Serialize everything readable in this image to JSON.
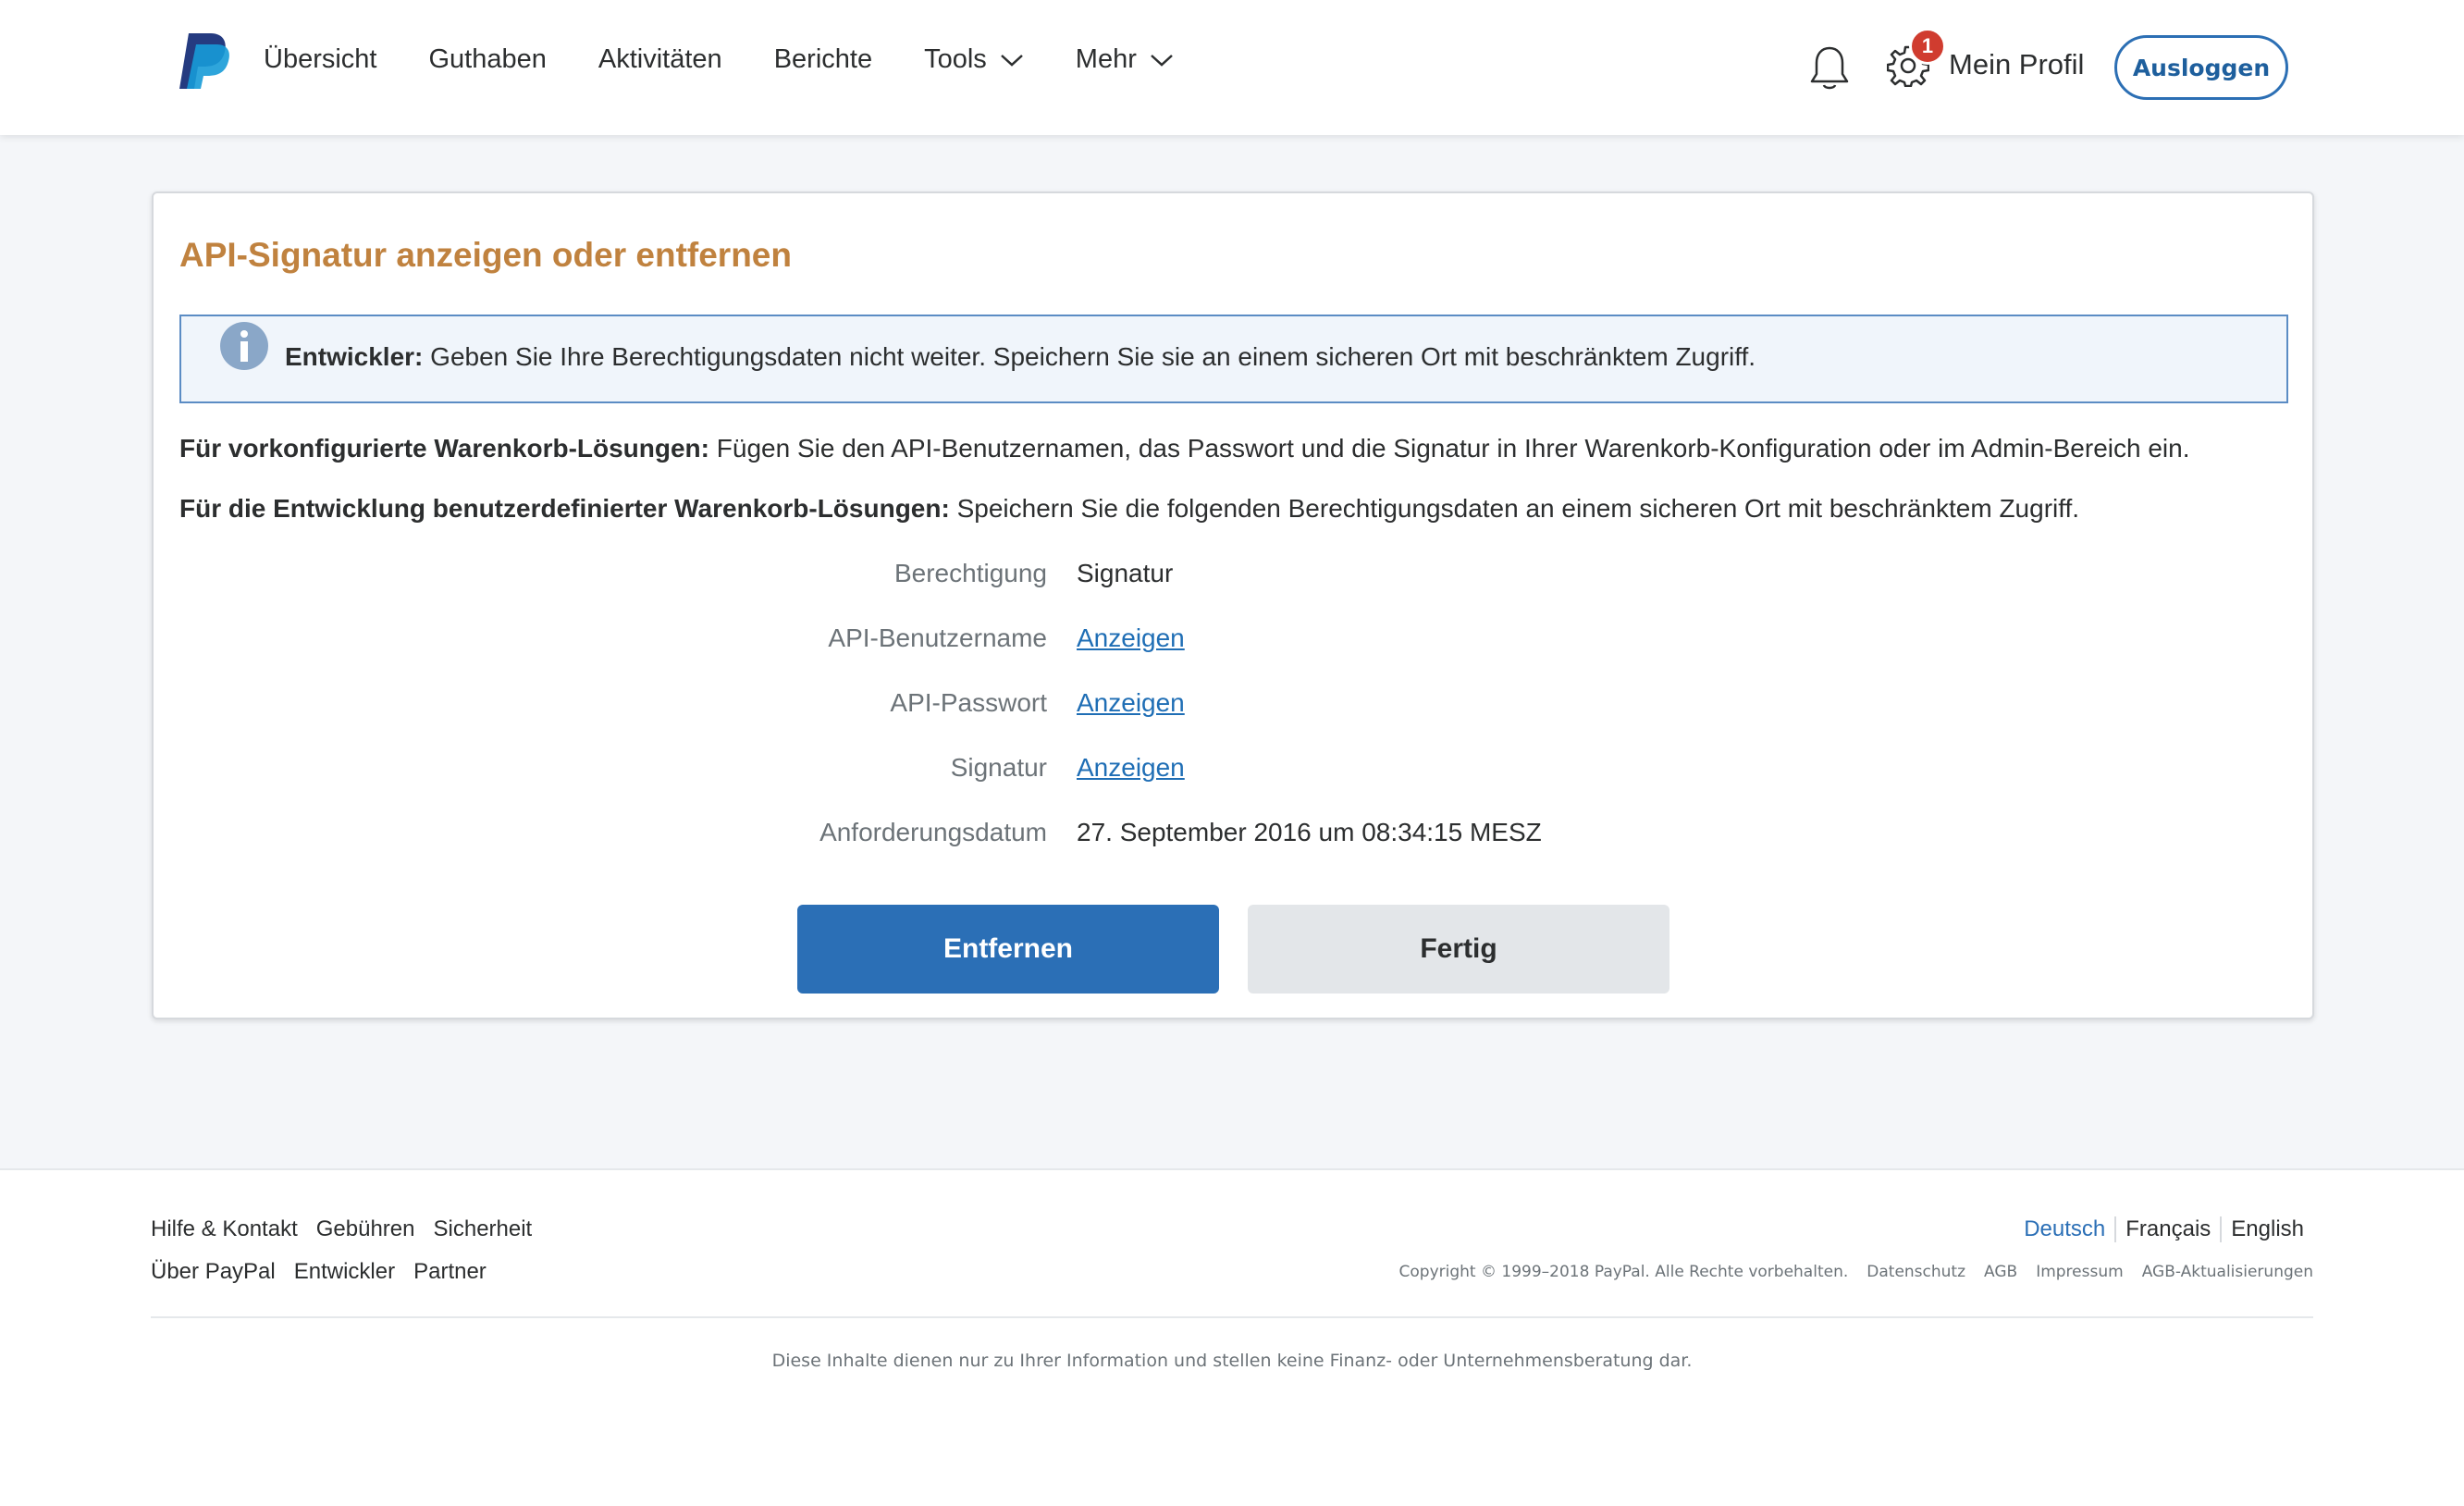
{
  "header": {
    "nav": [
      "Übersicht",
      "Guthaben",
      "Aktivitäten",
      "Berichte",
      "Tools",
      "Mehr"
    ],
    "notification_badge": "1",
    "profile_label": "Mein Profil",
    "logout_label": "Ausloggen"
  },
  "card": {
    "title": "API-Signatur anzeigen oder entfernen",
    "info_bold": "Entwickler:",
    "info_text": " Geben Sie Ihre Berechtigungsdaten nicht weiter. Speichern Sie sie an einem sicheren Ort mit beschränktem Zugriff.",
    "p1_bold": "Für vorkonfigurierte Warenkorb-Lösungen:",
    "p1_text": " Fügen Sie den API-Benutzernamen, das Passwort und die Signatur in Ihrer Warenkorb-Konfiguration oder im Admin-Bereich ein.",
    "p2_bold": "Für die Entwicklung benutzerdefinierter Warenkorb-Lösungen:",
    "p2_text": " Speichern Sie die folgenden Berechtigungsdaten an einem sicheren Ort mit beschränktem Zugriff.",
    "rows": [
      {
        "label": "Berechtigung",
        "value": "Signatur"
      },
      {
        "label": "API-Benutzername",
        "value": "Anzeigen"
      },
      {
        "label": "API-Passwort",
        "value": "Anzeigen"
      },
      {
        "label": "Signatur",
        "value": "Anzeigen"
      },
      {
        "label": "Anforderungsdatum",
        "value": "27. September 2016 um 08:34:15 MESZ"
      }
    ],
    "remove_label": "Entfernen",
    "done_label": "Fertig"
  },
  "footer": {
    "links_row1": [
      "Hilfe & Kontakt",
      "Gebühren",
      "Sicherheit"
    ],
    "links_row2": [
      "Über PayPal",
      "Entwickler",
      "Partner"
    ],
    "languages": [
      "Deutsch",
      "Français",
      "English"
    ],
    "copyright": "Copyright © 1999–2018 PayPal. Alle Rechte vorbehalten.",
    "legal_links": [
      "Datenschutz",
      "AGB",
      "Impressum",
      "AGB-Aktualisierungen"
    ],
    "disclaimer": "Diese Inhalte dienen nur zu Ihrer Information und stellen keine Finanz- oder Unternehmensberatung dar."
  },
  "colors": {
    "brand_blue": "#2b6fb6",
    "title_orange": "#c0823f",
    "badge_red": "#d03c2f"
  }
}
